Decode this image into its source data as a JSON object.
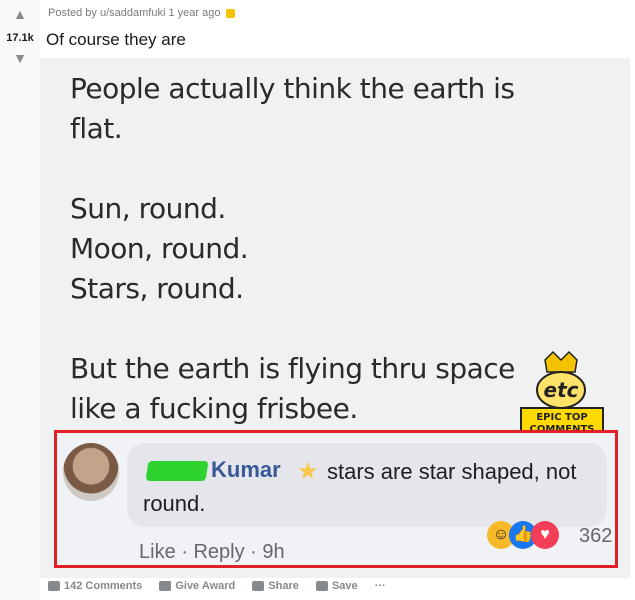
{
  "post": {
    "score": "17.1k",
    "meta_prefix": "Posted by u/saddamfuki 1 year ago",
    "title": "Of course they are"
  },
  "image": {
    "lines": [
      "People actually think the earth is",
      "flat.",
      "Sun, round.",
      "Moon, round.",
      "Stars, round.",
      "But the earth is flying thru space",
      "like a fucking frisbee."
    ],
    "logo": {
      "text1": "etc",
      "text2": "EPIC TOP",
      "text3": "COMMENTS"
    },
    "fb_comment": {
      "name": "Kumar",
      "text_line1": "stars are star shaped, not",
      "text_line2": "round.",
      "reaction_count": "362",
      "actions": "Like · Reply · 9h"
    }
  },
  "footer": {
    "comments": "142 Comments",
    "give_award": "Give Award",
    "share": "Share",
    "save": "Save",
    "more": "···"
  },
  "colors": {
    "accent_red": "#e21f26",
    "fb_blue": "#385898",
    "award_gold": "#f5c400"
  }
}
